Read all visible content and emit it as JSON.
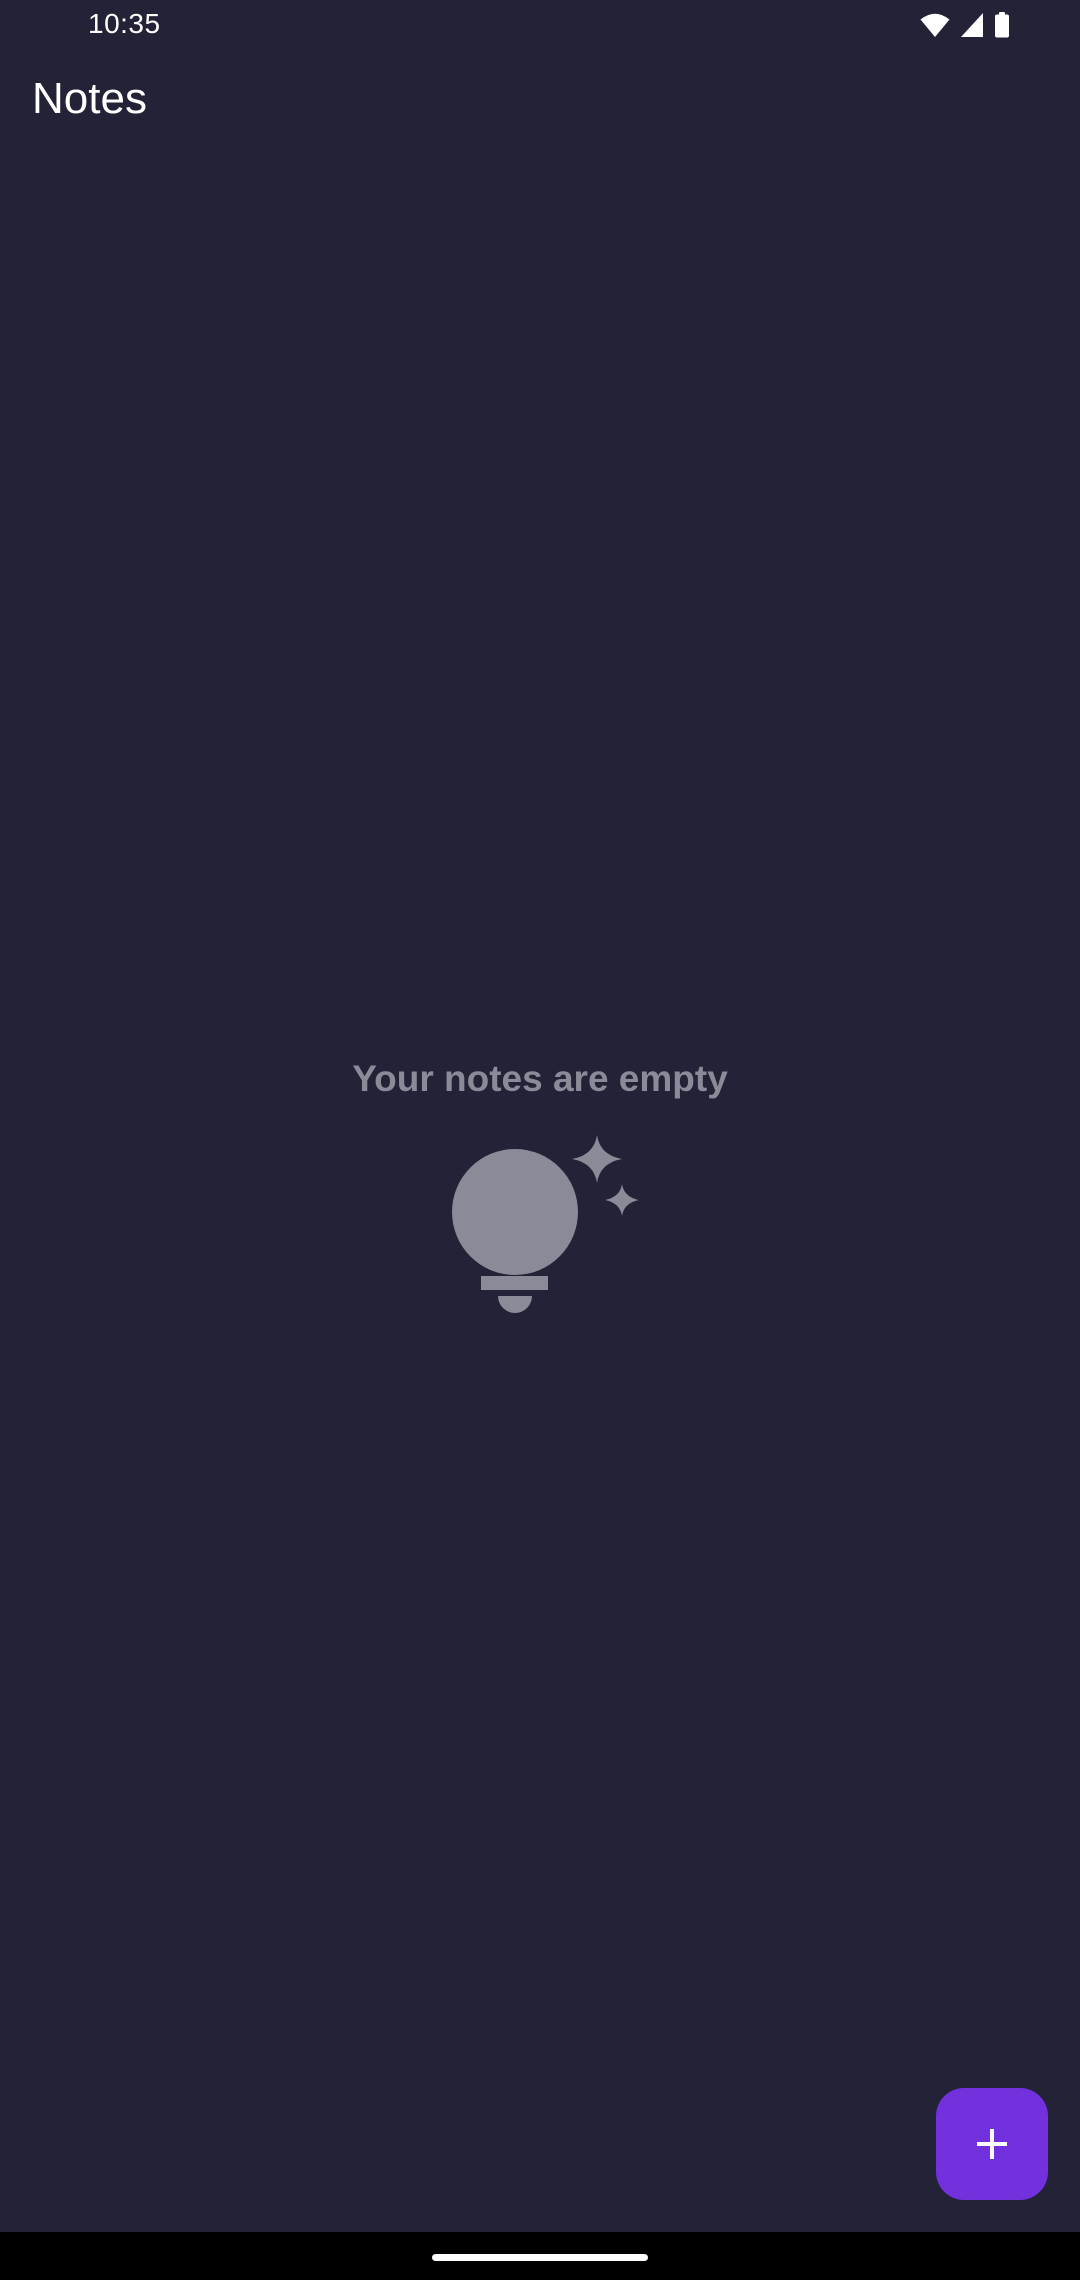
{
  "status_bar": {
    "time": "10:35",
    "icons": [
      "wifi-icon",
      "cellular-signal-icon",
      "battery-icon"
    ]
  },
  "app_bar": {
    "title": "Notes"
  },
  "empty_state": {
    "message": "Your notes are empty",
    "icon": "lightbulb-sparkle-icon"
  },
  "fab": {
    "icon": "plus-icon"
  },
  "colors": {
    "background": "#232236",
    "muted": "#8b8a98",
    "accent": "#7231dd",
    "nav_bar": "#000000"
  }
}
